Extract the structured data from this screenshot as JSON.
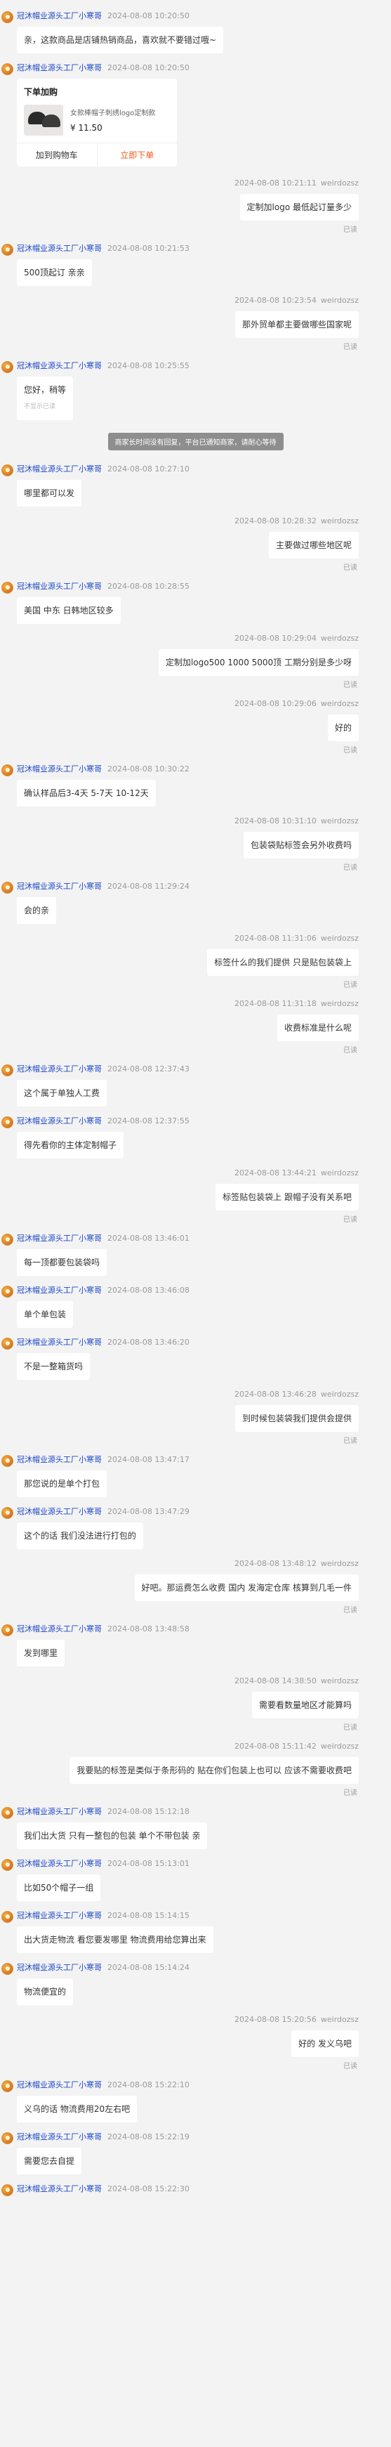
{
  "shop_name": "冠沐帽业源头工厂小寒哥",
  "customer_name": "weirdozsz",
  "read_label": "已读",
  "unread_label": "不显示已读",
  "product_card": {
    "title": "下单加购",
    "name": "女款棒帽子刺绣logo定制款",
    "price": "¥ 11.50",
    "add_to_cart": "加到购物车",
    "buy_now": "立即下单"
  },
  "messages": [
    {
      "type": "left",
      "time": "2024-08-08 10:20:50",
      "text": "亲，这款商品是店铺热销商品，喜欢就不要错过哦~"
    },
    {
      "type": "card",
      "time": "2024-08-08 10:20:50"
    },
    {
      "type": "right",
      "time": "2024-08-08 10:21:11",
      "text": "定制加logo 最低起订量多少"
    },
    {
      "type": "left",
      "time": "2024-08-08 10:21:53",
      "text": "500顶起订 亲亲"
    },
    {
      "type": "right",
      "time": "2024-08-08 10:23:54",
      "text": "那外贸单都主要做哪些国家呢"
    },
    {
      "type": "left",
      "time": "2024-08-08 10:25:55",
      "text": "您好，稍等",
      "unread": true
    },
    {
      "type": "system",
      "text": "商家长时间没有回复，平台已通知商家，请耐心等待"
    },
    {
      "type": "left",
      "time": "2024-08-08 10:27:10",
      "text": "哪里都可以发"
    },
    {
      "type": "right",
      "time": "2024-08-08 10:28:32",
      "text": "主要做过哪些地区呢"
    },
    {
      "type": "left",
      "time": "2024-08-08 10:28:55",
      "text": "美国 中东 日韩地区较多"
    },
    {
      "type": "right",
      "time": "2024-08-08 10:29:04",
      "text": "定制加logo500 1000 5000顶 工期分别是多少呀"
    },
    {
      "type": "right",
      "time": "2024-08-08 10:29:06",
      "text": "好的"
    },
    {
      "type": "left",
      "time": "2024-08-08 10:30:22",
      "text": "确认样品后3-4天 5-7天 10-12天"
    },
    {
      "type": "right",
      "time": "2024-08-08 10:31:10",
      "text": "包装袋贴标签会另外收费吗"
    },
    {
      "type": "left",
      "time": "2024-08-08 11:29:24",
      "text": "会的亲"
    },
    {
      "type": "right",
      "time": "2024-08-08 11:31:06",
      "text": "标签什么的我们提供 只是贴包装袋上"
    },
    {
      "type": "right",
      "time": "2024-08-08 11:31:18",
      "text": "收费标准是什么呢"
    },
    {
      "type": "left",
      "time": "2024-08-08 12:37:43",
      "text": "这个属于单独人工费"
    },
    {
      "type": "left",
      "time": "2024-08-08 12:37:55",
      "text": "得先看你的主体定制帽子"
    },
    {
      "type": "right",
      "time": "2024-08-08 13:44:21",
      "text": "标签贴包装袋上 跟帽子没有关系吧"
    },
    {
      "type": "left",
      "time": "2024-08-08 13:46:01",
      "text": "每一顶都要包装袋吗"
    },
    {
      "type": "left",
      "time": "2024-08-08 13:46:08",
      "text": "单个单包装"
    },
    {
      "type": "left",
      "time": "2024-08-08 13:46:20",
      "text": "不是一整箱货吗"
    },
    {
      "type": "right",
      "time": "2024-08-08 13:46:28",
      "text": "到时候包装袋我们提供会提供"
    },
    {
      "type": "left",
      "time": "2024-08-08 13:47:17",
      "text": "那您说的是单个打包"
    },
    {
      "type": "left",
      "time": "2024-08-08 13:47:29",
      "text": "这个的话 我们没法进行打包的"
    },
    {
      "type": "right",
      "time": "2024-08-08 13:48:12",
      "text": "好吧。那运费怎么收费 国内 发海定仓库 核算到几毛一件"
    },
    {
      "type": "left",
      "time": "2024-08-08 13:48:58",
      "text": "发到哪里"
    },
    {
      "type": "right",
      "time": "2024-08-08 14:38:50",
      "text": "需要看数量地区才能算吗"
    },
    {
      "type": "right",
      "time": "2024-08-08 15:11:42",
      "text": "我要贴的标签是类似于条形码的 贴在你们包装上也可以 应该不需要收费吧"
    },
    {
      "type": "left",
      "time": "2024-08-08 15:12:18",
      "text": "我们出大货 只有一整包的包装 单个不带包装 亲"
    },
    {
      "type": "left",
      "time": "2024-08-08 15:13:01",
      "text": "比如50个帽子一组"
    },
    {
      "type": "left",
      "time": "2024-08-08 15:14:15",
      "text": "出大货走物流 看您要发哪里 物流费用给您算出来"
    },
    {
      "type": "left",
      "time": "2024-08-08 15:14:24",
      "text": "物流便宜的"
    },
    {
      "type": "right",
      "time": "2024-08-08 15:20:56",
      "text": "好的 发义乌吧"
    },
    {
      "type": "left",
      "time": "2024-08-08 15:22:10",
      "text": "义乌的话 物流费用20左右吧"
    },
    {
      "type": "left",
      "time": "2024-08-08 15:22:19",
      "text": "需要您去自提"
    },
    {
      "type": "left",
      "time": "2024-08-08 15:22:30",
      "text": ""
    }
  ]
}
